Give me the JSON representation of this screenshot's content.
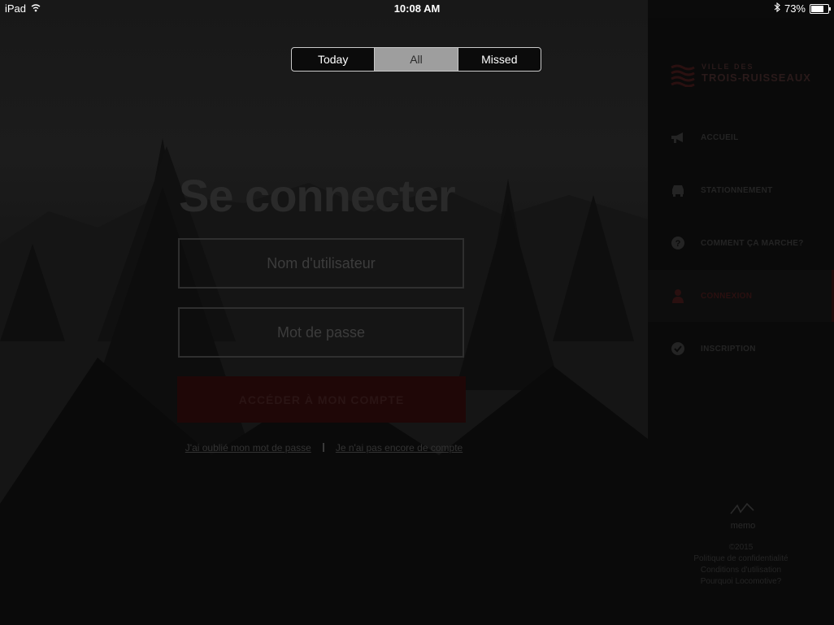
{
  "status_bar": {
    "device": "iPad",
    "time": "10:08 AM",
    "battery": "73%",
    "battery_level": 0.73
  },
  "segmented": {
    "options": [
      "Today",
      "All",
      "Missed"
    ],
    "selected": "All"
  },
  "login": {
    "title": "Se connecter",
    "username_placeholder": "Nom d'utilisateur",
    "password_placeholder": "Mot de passe",
    "submit_label": "ACCÉDER À MON COMPTE",
    "forgot_link": "J'ai oublié mon mot de passe",
    "signup_link": "Je n'ai pas encore de compte"
  },
  "sidebar": {
    "logo_line1": "VILLE DES",
    "logo_line2": "TROIS-RUISSEAUX",
    "items": [
      {
        "label": "ACCUEIL",
        "icon": "megaphone-icon"
      },
      {
        "label": "STATIONNEMENT",
        "icon": "car-icon"
      },
      {
        "label": "COMMENT ÇA MARCHE?",
        "icon": "question-icon"
      },
      {
        "label": "CONNEXION",
        "icon": "user-icon"
      },
      {
        "label": "INSCRIPTION",
        "icon": "check-circle-icon"
      }
    ],
    "active_item": "CONNEXION",
    "memo_label": "memo",
    "footer": {
      "copyright": "©2015",
      "privacy": "Politique de confidentialité",
      "terms": "Conditions d'utilisation",
      "why": "Pourquoi Locomotive?"
    }
  },
  "colors": {
    "accent": "#8b1a1a",
    "sidebar_bg": "#0a0a0a"
  }
}
